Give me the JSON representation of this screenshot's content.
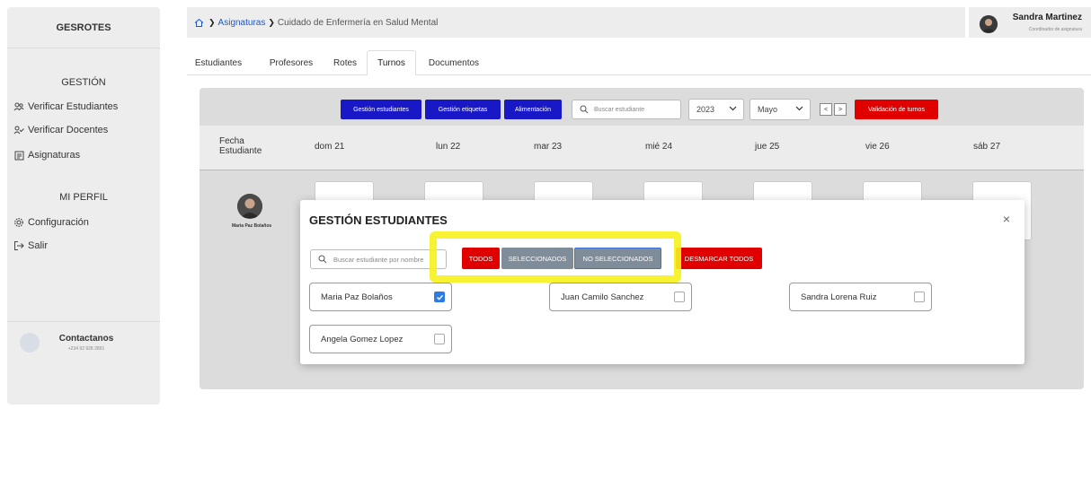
{
  "sidebar": {
    "brand": "GESROTES",
    "section_gestion": "GESTIÓN",
    "items": [
      {
        "label": "Verificar Estudiantes",
        "icon": "users-icon"
      },
      {
        "label": "Verificar Docentes",
        "icon": "user-check-icon"
      },
      {
        "label": "Asignaturas",
        "icon": "document-icon"
      }
    ],
    "section_perfil": "MI PERFIL",
    "profile_items": [
      {
        "label": "Configuración",
        "icon": "gear-icon"
      },
      {
        "label": "Salir",
        "icon": "logout-icon"
      }
    ],
    "contact": {
      "title": "Contactanos",
      "phone": "+234 92 928 2891"
    }
  },
  "breadcrumb": {
    "root": "Asignaturas",
    "current": "Cuidado de Enfermería en Salud Mental"
  },
  "user": {
    "name": "Sandra Martinez",
    "role": "Coordinador de asignatura"
  },
  "tabs": [
    {
      "label": "Estudiantes"
    },
    {
      "label": "Profesores"
    },
    {
      "label": "Rotes"
    },
    {
      "label": "Turnos",
      "active": true
    },
    {
      "label": "Documentos"
    }
  ],
  "toolbar": {
    "btn_gestion_estudiantes": "Gestión estudiantes",
    "btn_gestion_etiquetas": "Gestión etiquetas",
    "btn_alimentacion": "Alimentación",
    "search_placeholder": "Buscar estudiante",
    "year": "2023",
    "month": "Mayo",
    "prev": "<",
    "next": ">",
    "btn_validacion": "Validación de turnos"
  },
  "calendar": {
    "label_fecha": "Fecha",
    "label_estudiante": "Estudiante",
    "days": [
      "dom 21",
      "lun 22",
      "mar 23",
      "mié 24",
      "jue 25",
      "vie 26",
      "sáb 27"
    ],
    "row_student": "Maria Paz Bolaños"
  },
  "modal": {
    "title": "GESTIÓN ESTUDIANTES",
    "close": "×",
    "search_placeholder": "Buscar estudiante por nombre",
    "filters": {
      "todos": "TODOS",
      "seleccionados": "SELECCIONADOS",
      "no_seleccionados": "NO SELECCIONADOS",
      "desmarcar": "DESMARCAR TODOS"
    },
    "students": [
      {
        "name": "Maria Paz Bolaños",
        "checked": true
      },
      {
        "name": "Juan Camilo Sanchez",
        "checked": false
      },
      {
        "name": "Sandra Lorena Ruiz",
        "checked": false
      },
      {
        "name": "Angela Gomez Lopez",
        "checked": false
      }
    ]
  },
  "colors": {
    "primary_blue": "#1818c6",
    "danger_red": "#e10000",
    "filter_gray": "#7f8c9a",
    "highlight_yellow": "#f6f21c",
    "check_blue": "#2f7be6"
  }
}
